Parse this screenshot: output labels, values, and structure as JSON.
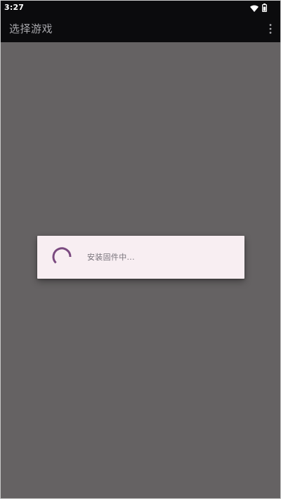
{
  "status_bar": {
    "time": "3:27",
    "icons": [
      "wifi-icon",
      "battery-icon"
    ]
  },
  "app_bar": {
    "title": "选择游戏",
    "menu_icon": "more-vert-icon"
  },
  "dialog": {
    "message": "安装固件中...",
    "spinner_icon": "progress-spinner-icon"
  },
  "colors": {
    "bar_background": "#0b0b0d",
    "scrim_background": "#656263",
    "dialog_background": "#f8eef2",
    "spinner_accent": "#7b4a80",
    "title_text": "#a7a7ab",
    "message_text": "#77727a"
  }
}
